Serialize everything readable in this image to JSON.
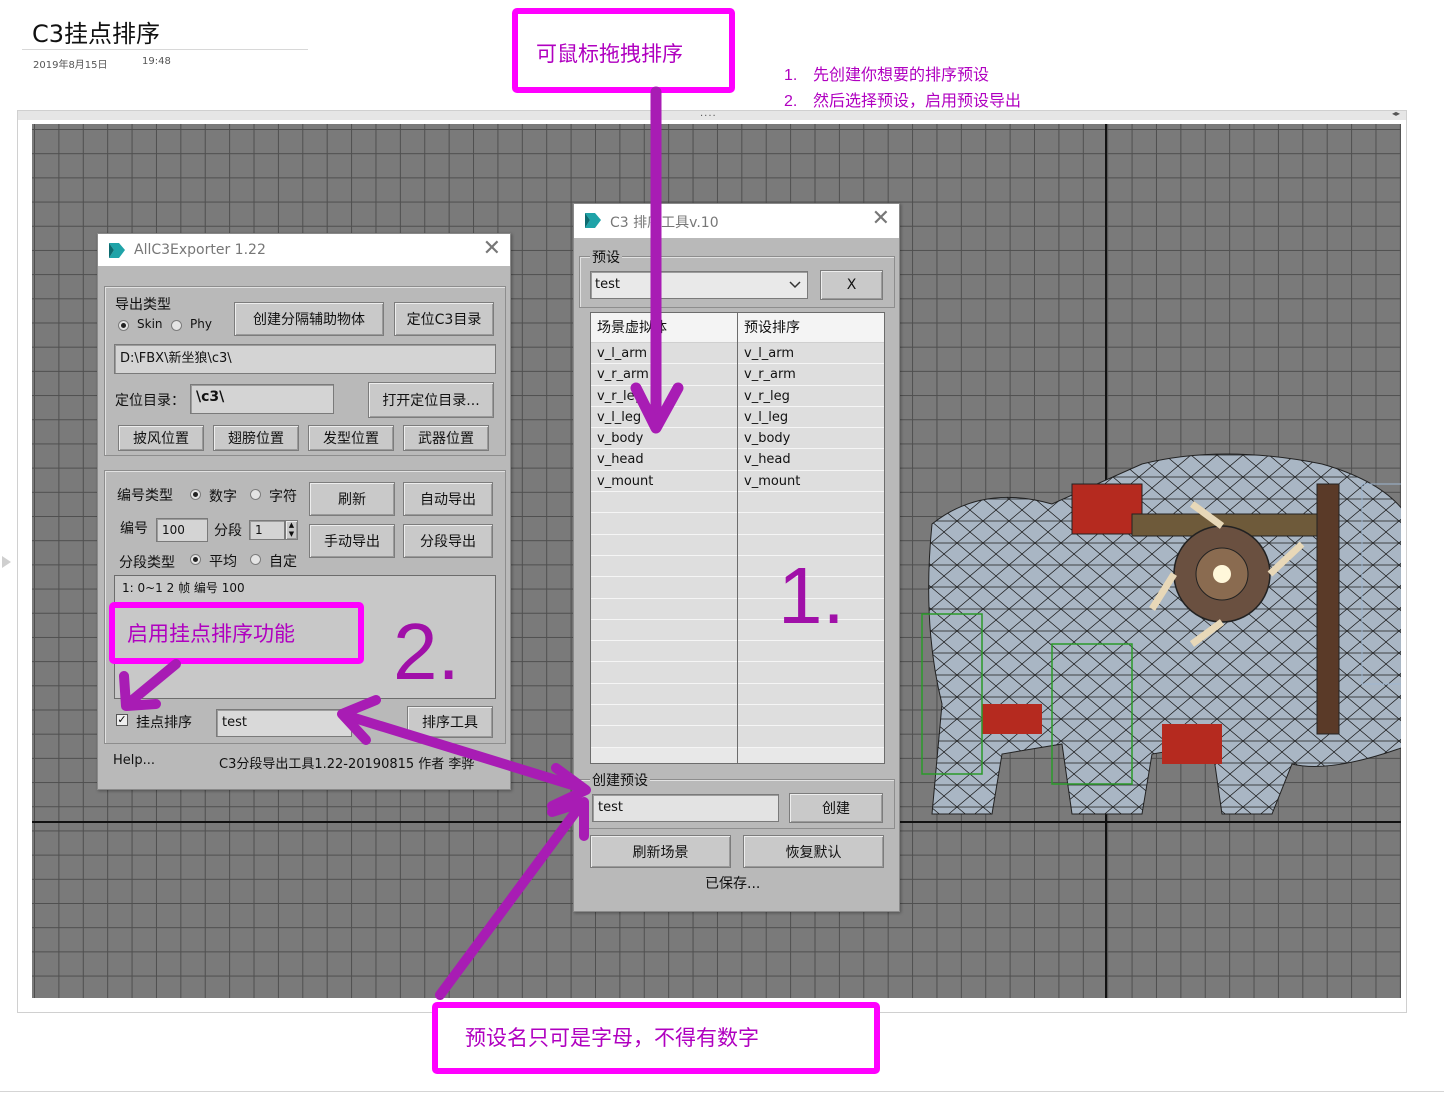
{
  "page": {
    "title": "C3挂点排序",
    "date": "2019年8月15日",
    "time": "19:48"
  },
  "notes": [
    {
      "num": "1.",
      "text": "先创建你想要的排序预设"
    },
    {
      "num": "2.",
      "text": "然后选择预设，启用预设导出"
    }
  ],
  "frame": {
    "dots": "....",
    "arrows": "◂▸"
  },
  "exporter": {
    "title": "AllC3Exporter 1.22",
    "close_glyph": "✕",
    "export_type_label": "导出类型",
    "radio_skin": "Skin",
    "radio_phy": "Phy",
    "create_helper_button": "创建分隔辅助物体",
    "locate_c3_button": "定位C3目录",
    "path_value": "D:\\FBX\\新坐狼\\c3\\",
    "locate_dir_label": "定位目录：",
    "locate_dir_value": "\\c3\\",
    "open_dir_button": "打开定位目录...",
    "cape_button": "披风位置",
    "wing_button": "翅膀位置",
    "hair_button": "发型位置",
    "weapon_button": "武器位置",
    "number_type_label": "编号类型",
    "radio_number": "数字",
    "radio_char": "字符",
    "refresh_button": "刷新",
    "auto_export_button": "自动导出",
    "number_label": "编号",
    "number_value": "100",
    "segment_label": "分段",
    "segment_value": "1",
    "manual_export_button": "手动导出",
    "segment_export_button": "分段导出",
    "segment_type_label": "分段类型",
    "radio_average": "平均",
    "radio_custom": "自定",
    "segment_list_text": "1: 0~1 2 帧 编号 100",
    "mount_sort_label": "挂点排序",
    "mount_sort_checked": "✓",
    "preset_value": "test",
    "sort_tool_button": "排序工具",
    "help_link": "Help...",
    "footer_text": "C3分段导出工具1.22-20190815 作者 李骅"
  },
  "sorter": {
    "title": "C3 排序工具v.10",
    "close_glyph": "✕",
    "preset_group_label": "预设",
    "preset_selected": "test",
    "delete_button": "X",
    "col_scene": "场景虚拟体",
    "col_preset": "预设排序",
    "scene_items": [
      "v_l_arm",
      "v_r_arm",
      "v_r_leg",
      "v_l_leg",
      "v_body",
      "v_head",
      "v_mount"
    ],
    "preset_items": [
      "v_l_arm",
      "v_r_arm",
      "v_r_leg",
      "v_l_leg",
      "v_body",
      "v_head",
      "v_mount"
    ],
    "create_group_label": "创建预设",
    "create_input_value": "test",
    "create_button": "创建",
    "refresh_scene_button": "刷新场景",
    "restore_default_button": "恢复默认",
    "status_text": "已保存..."
  },
  "annotations": {
    "drag_note": "可鼠标拖拽排序",
    "enable_note": "启用挂点排序功能",
    "name_note": "预设名只可是字母，不得有数字",
    "label_1": "1.",
    "label_2": "2."
  },
  "colors": {
    "annotation_magenta": "#ff00ff",
    "annotation_text": "#b000c0",
    "arrow_purple": "#9a1fa6",
    "viewport_bg": "#7a7a7a"
  }
}
